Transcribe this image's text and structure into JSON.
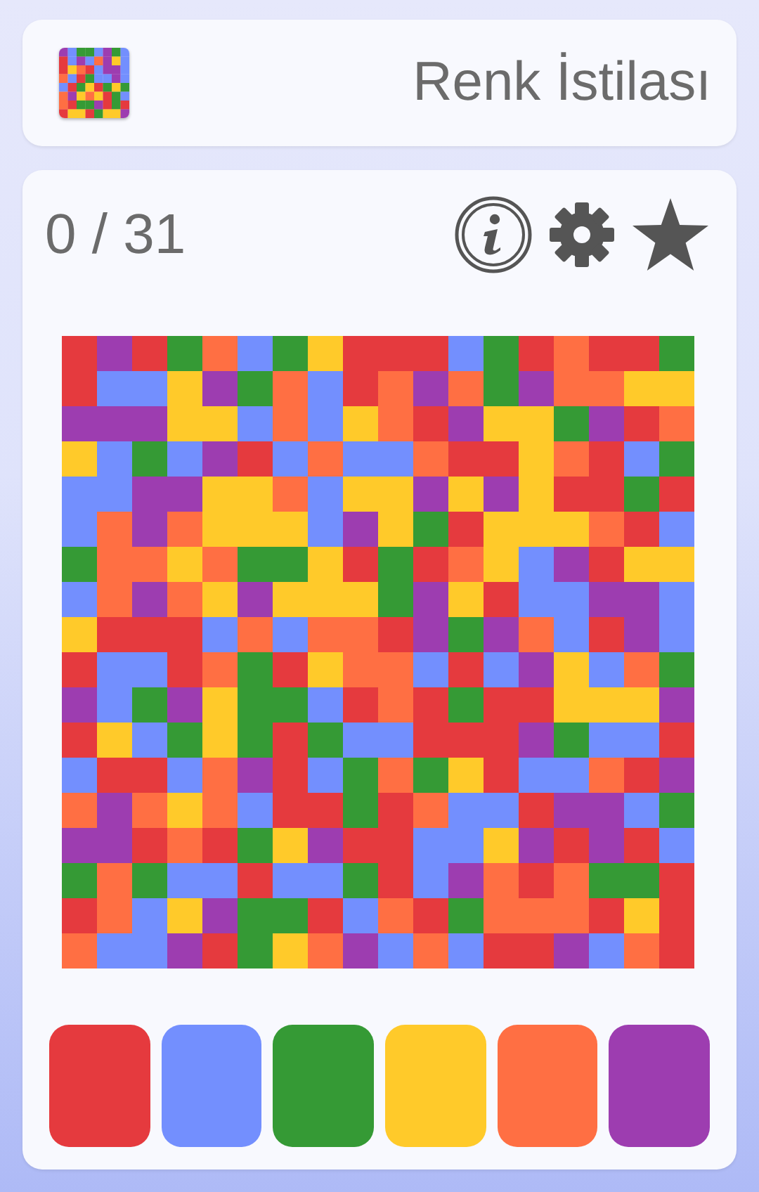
{
  "header": {
    "title": "Renk İstilası"
  },
  "score": {
    "text": "0 / 31"
  },
  "colors": [
    {
      "color": "#e53a3e"
    },
    {
      "color": "#738ffe"
    },
    {
      "color": "#359a35"
    },
    {
      "color": "#ffca2a"
    },
    {
      "color": "#ff6f43"
    },
    {
      "color": "#9d3db0"
    }
  ],
  "board": {
    "rows": [
      {
        "cells": [
          {
            "color": "#e53a3e"
          },
          {
            "color": "#9d3db0"
          },
          {
            "color": "#e53a3e"
          },
          {
            "color": "#359a35"
          },
          {
            "color": "#ff6f43"
          },
          {
            "color": "#738ffe"
          },
          {
            "color": "#359a35"
          },
          {
            "color": "#ffca2a"
          },
          {
            "color": "#e53a3e"
          },
          {
            "color": "#e53a3e"
          },
          {
            "color": "#e53a3e"
          },
          {
            "color": "#738ffe"
          },
          {
            "color": "#359a35"
          },
          {
            "color": "#e53a3e"
          },
          {
            "color": "#ff6f43"
          },
          {
            "color": "#e53a3e"
          },
          {
            "color": "#e53a3e"
          },
          {
            "color": "#359a35"
          }
        ]
      },
      {
        "cells": [
          {
            "color": "#e53a3e"
          },
          {
            "color": "#738ffe"
          },
          {
            "color": "#738ffe"
          },
          {
            "color": "#ffca2a"
          },
          {
            "color": "#9d3db0"
          },
          {
            "color": "#359a35"
          },
          {
            "color": "#ff6f43"
          },
          {
            "color": "#738ffe"
          },
          {
            "color": "#e53a3e"
          },
          {
            "color": "#ff6f43"
          },
          {
            "color": "#9d3db0"
          },
          {
            "color": "#ff6f43"
          },
          {
            "color": "#359a35"
          },
          {
            "color": "#9d3db0"
          },
          {
            "color": "#ff6f43"
          },
          {
            "color": "#ff6f43"
          },
          {
            "color": "#ffca2a"
          },
          {
            "color": "#ffca2a"
          }
        ]
      },
      {
        "cells": [
          {
            "color": "#9d3db0"
          },
          {
            "color": "#9d3db0"
          },
          {
            "color": "#9d3db0"
          },
          {
            "color": "#ffca2a"
          },
          {
            "color": "#ffca2a"
          },
          {
            "color": "#738ffe"
          },
          {
            "color": "#ff6f43"
          },
          {
            "color": "#738ffe"
          },
          {
            "color": "#ffca2a"
          },
          {
            "color": "#ff6f43"
          },
          {
            "color": "#e53a3e"
          },
          {
            "color": "#9d3db0"
          },
          {
            "color": "#ffca2a"
          },
          {
            "color": "#ffca2a"
          },
          {
            "color": "#359a35"
          },
          {
            "color": "#9d3db0"
          },
          {
            "color": "#e53a3e"
          },
          {
            "color": "#ff6f43"
          }
        ]
      },
      {
        "cells": [
          {
            "color": "#ffca2a"
          },
          {
            "color": "#738ffe"
          },
          {
            "color": "#359a35"
          },
          {
            "color": "#738ffe"
          },
          {
            "color": "#9d3db0"
          },
          {
            "color": "#e53a3e"
          },
          {
            "color": "#738ffe"
          },
          {
            "color": "#ff6f43"
          },
          {
            "color": "#738ffe"
          },
          {
            "color": "#738ffe"
          },
          {
            "color": "#ff6f43"
          },
          {
            "color": "#e53a3e"
          },
          {
            "color": "#e53a3e"
          },
          {
            "color": "#ffca2a"
          },
          {
            "color": "#ff6f43"
          },
          {
            "color": "#e53a3e"
          },
          {
            "color": "#738ffe"
          },
          {
            "color": "#359a35"
          }
        ]
      },
      {
        "cells": [
          {
            "color": "#738ffe"
          },
          {
            "color": "#738ffe"
          },
          {
            "color": "#9d3db0"
          },
          {
            "color": "#9d3db0"
          },
          {
            "color": "#ffca2a"
          },
          {
            "color": "#ffca2a"
          },
          {
            "color": "#ff6f43"
          },
          {
            "color": "#738ffe"
          },
          {
            "color": "#ffca2a"
          },
          {
            "color": "#ffca2a"
          },
          {
            "color": "#9d3db0"
          },
          {
            "color": "#ffca2a"
          },
          {
            "color": "#9d3db0"
          },
          {
            "color": "#ffca2a"
          },
          {
            "color": "#e53a3e"
          },
          {
            "color": "#e53a3e"
          },
          {
            "color": "#359a35"
          },
          {
            "color": "#e53a3e"
          }
        ]
      },
      {
        "cells": [
          {
            "color": "#738ffe"
          },
          {
            "color": "#ff6f43"
          },
          {
            "color": "#9d3db0"
          },
          {
            "color": "#ff6f43"
          },
          {
            "color": "#ffca2a"
          },
          {
            "color": "#ffca2a"
          },
          {
            "color": "#ffca2a"
          },
          {
            "color": "#738ffe"
          },
          {
            "color": "#9d3db0"
          },
          {
            "color": "#ffca2a"
          },
          {
            "color": "#359a35"
          },
          {
            "color": "#e53a3e"
          },
          {
            "color": "#ffca2a"
          },
          {
            "color": "#ffca2a"
          },
          {
            "color": "#ffca2a"
          },
          {
            "color": "#ff6f43"
          },
          {
            "color": "#e53a3e"
          },
          {
            "color": "#738ffe"
          }
        ]
      },
      {
        "cells": [
          {
            "color": "#359a35"
          },
          {
            "color": "#ff6f43"
          },
          {
            "color": "#ff6f43"
          },
          {
            "color": "#ffca2a"
          },
          {
            "color": "#ff6f43"
          },
          {
            "color": "#359a35"
          },
          {
            "color": "#359a35"
          },
          {
            "color": "#ffca2a"
          },
          {
            "color": "#e53a3e"
          },
          {
            "color": "#359a35"
          },
          {
            "color": "#e53a3e"
          },
          {
            "color": "#ff6f43"
          },
          {
            "color": "#ffca2a"
          },
          {
            "color": "#738ffe"
          },
          {
            "color": "#9d3db0"
          },
          {
            "color": "#e53a3e"
          },
          {
            "color": "#ffca2a"
          },
          {
            "color": "#ffca2a"
          }
        ]
      },
      {
        "cells": [
          {
            "color": "#738ffe"
          },
          {
            "color": "#ff6f43"
          },
          {
            "color": "#9d3db0"
          },
          {
            "color": "#ff6f43"
          },
          {
            "color": "#ffca2a"
          },
          {
            "color": "#9d3db0"
          },
          {
            "color": "#ffca2a"
          },
          {
            "color": "#ffca2a"
          },
          {
            "color": "#ffca2a"
          },
          {
            "color": "#359a35"
          },
          {
            "color": "#9d3db0"
          },
          {
            "color": "#ffca2a"
          },
          {
            "color": "#e53a3e"
          },
          {
            "color": "#738ffe"
          },
          {
            "color": "#738ffe"
          },
          {
            "color": "#9d3db0"
          },
          {
            "color": "#9d3db0"
          },
          {
            "color": "#738ffe"
          }
        ]
      },
      {
        "cells": [
          {
            "color": "#ffca2a"
          },
          {
            "color": "#e53a3e"
          },
          {
            "color": "#e53a3e"
          },
          {
            "color": "#e53a3e"
          },
          {
            "color": "#738ffe"
          },
          {
            "color": "#ff6f43"
          },
          {
            "color": "#738ffe"
          },
          {
            "color": "#ff6f43"
          },
          {
            "color": "#ff6f43"
          },
          {
            "color": "#e53a3e"
          },
          {
            "color": "#9d3db0"
          },
          {
            "color": "#359a35"
          },
          {
            "color": "#9d3db0"
          },
          {
            "color": "#ff6f43"
          },
          {
            "color": "#738ffe"
          },
          {
            "color": "#e53a3e"
          },
          {
            "color": "#9d3db0"
          },
          {
            "color": "#738ffe"
          }
        ]
      },
      {
        "cells": [
          {
            "color": "#e53a3e"
          },
          {
            "color": "#738ffe"
          },
          {
            "color": "#738ffe"
          },
          {
            "color": "#e53a3e"
          },
          {
            "color": "#ff6f43"
          },
          {
            "color": "#359a35"
          },
          {
            "color": "#e53a3e"
          },
          {
            "color": "#ffca2a"
          },
          {
            "color": "#ff6f43"
          },
          {
            "color": "#ff6f43"
          },
          {
            "color": "#738ffe"
          },
          {
            "color": "#e53a3e"
          },
          {
            "color": "#738ffe"
          },
          {
            "color": "#9d3db0"
          },
          {
            "color": "#ffca2a"
          },
          {
            "color": "#738ffe"
          },
          {
            "color": "#ff6f43"
          },
          {
            "color": "#359a35"
          }
        ]
      },
      {
        "cells": [
          {
            "color": "#9d3db0"
          },
          {
            "color": "#738ffe"
          },
          {
            "color": "#359a35"
          },
          {
            "color": "#9d3db0"
          },
          {
            "color": "#ffca2a"
          },
          {
            "color": "#359a35"
          },
          {
            "color": "#359a35"
          },
          {
            "color": "#738ffe"
          },
          {
            "color": "#e53a3e"
          },
          {
            "color": "#ff6f43"
          },
          {
            "color": "#e53a3e"
          },
          {
            "color": "#359a35"
          },
          {
            "color": "#e53a3e"
          },
          {
            "color": "#e53a3e"
          },
          {
            "color": "#ffca2a"
          },
          {
            "color": "#ffca2a"
          },
          {
            "color": "#ffca2a"
          },
          {
            "color": "#9d3db0"
          }
        ]
      },
      {
        "cells": [
          {
            "color": "#e53a3e"
          },
          {
            "color": "#ffca2a"
          },
          {
            "color": "#738ffe"
          },
          {
            "color": "#359a35"
          },
          {
            "color": "#ffca2a"
          },
          {
            "color": "#359a35"
          },
          {
            "color": "#e53a3e"
          },
          {
            "color": "#359a35"
          },
          {
            "color": "#738ffe"
          },
          {
            "color": "#738ffe"
          },
          {
            "color": "#e53a3e"
          },
          {
            "color": "#e53a3e"
          },
          {
            "color": "#e53a3e"
          },
          {
            "color": "#9d3db0"
          },
          {
            "color": "#359a35"
          },
          {
            "color": "#738ffe"
          },
          {
            "color": "#738ffe"
          },
          {
            "color": "#e53a3e"
          }
        ]
      },
      {
        "cells": [
          {
            "color": "#738ffe"
          },
          {
            "color": "#e53a3e"
          },
          {
            "color": "#e53a3e"
          },
          {
            "color": "#738ffe"
          },
          {
            "color": "#ff6f43"
          },
          {
            "color": "#9d3db0"
          },
          {
            "color": "#e53a3e"
          },
          {
            "color": "#738ffe"
          },
          {
            "color": "#359a35"
          },
          {
            "color": "#ff6f43"
          },
          {
            "color": "#359a35"
          },
          {
            "color": "#ffca2a"
          },
          {
            "color": "#e53a3e"
          },
          {
            "color": "#738ffe"
          },
          {
            "color": "#738ffe"
          },
          {
            "color": "#ff6f43"
          },
          {
            "color": "#e53a3e"
          },
          {
            "color": "#9d3db0"
          }
        ]
      },
      {
        "cells": [
          {
            "color": "#ff6f43"
          },
          {
            "color": "#9d3db0"
          },
          {
            "color": "#ff6f43"
          },
          {
            "color": "#ffca2a"
          },
          {
            "color": "#ff6f43"
          },
          {
            "color": "#738ffe"
          },
          {
            "color": "#e53a3e"
          },
          {
            "color": "#e53a3e"
          },
          {
            "color": "#359a35"
          },
          {
            "color": "#e53a3e"
          },
          {
            "color": "#ff6f43"
          },
          {
            "color": "#738ffe"
          },
          {
            "color": "#738ffe"
          },
          {
            "color": "#e53a3e"
          },
          {
            "color": "#9d3db0"
          },
          {
            "color": "#9d3db0"
          },
          {
            "color": "#738ffe"
          },
          {
            "color": "#359a35"
          }
        ]
      },
      {
        "cells": [
          {
            "color": "#9d3db0"
          },
          {
            "color": "#9d3db0"
          },
          {
            "color": "#e53a3e"
          },
          {
            "color": "#ff6f43"
          },
          {
            "color": "#e53a3e"
          },
          {
            "color": "#359a35"
          },
          {
            "color": "#ffca2a"
          },
          {
            "color": "#9d3db0"
          },
          {
            "color": "#e53a3e"
          },
          {
            "color": "#e53a3e"
          },
          {
            "color": "#738ffe"
          },
          {
            "color": "#738ffe"
          },
          {
            "color": "#ffca2a"
          },
          {
            "color": "#9d3db0"
          },
          {
            "color": "#e53a3e"
          },
          {
            "color": "#9d3db0"
          },
          {
            "color": "#e53a3e"
          },
          {
            "color": "#738ffe"
          }
        ]
      },
      {
        "cells": [
          {
            "color": "#359a35"
          },
          {
            "color": "#ff6f43"
          },
          {
            "color": "#359a35"
          },
          {
            "color": "#738ffe"
          },
          {
            "color": "#738ffe"
          },
          {
            "color": "#e53a3e"
          },
          {
            "color": "#738ffe"
          },
          {
            "color": "#738ffe"
          },
          {
            "color": "#359a35"
          },
          {
            "color": "#e53a3e"
          },
          {
            "color": "#738ffe"
          },
          {
            "color": "#9d3db0"
          },
          {
            "color": "#ff6f43"
          },
          {
            "color": "#e53a3e"
          },
          {
            "color": "#ff6f43"
          },
          {
            "color": "#359a35"
          },
          {
            "color": "#359a35"
          },
          {
            "color": "#e53a3e"
          }
        ]
      },
      {
        "cells": [
          {
            "color": "#e53a3e"
          },
          {
            "color": "#ff6f43"
          },
          {
            "color": "#738ffe"
          },
          {
            "color": "#ffca2a"
          },
          {
            "color": "#9d3db0"
          },
          {
            "color": "#359a35"
          },
          {
            "color": "#359a35"
          },
          {
            "color": "#e53a3e"
          },
          {
            "color": "#738ffe"
          },
          {
            "color": "#ff6f43"
          },
          {
            "color": "#e53a3e"
          },
          {
            "color": "#359a35"
          },
          {
            "color": "#ff6f43"
          },
          {
            "color": "#ff6f43"
          },
          {
            "color": "#ff6f43"
          },
          {
            "color": "#e53a3e"
          },
          {
            "color": "#ffca2a"
          },
          {
            "color": "#e53a3e"
          }
        ]
      },
      {
        "cells": [
          {
            "color": "#ff6f43"
          },
          {
            "color": "#738ffe"
          },
          {
            "color": "#738ffe"
          },
          {
            "color": "#9d3db0"
          },
          {
            "color": "#e53a3e"
          },
          {
            "color": "#359a35"
          },
          {
            "color": "#ffca2a"
          },
          {
            "color": "#ff6f43"
          },
          {
            "color": "#9d3db0"
          },
          {
            "color": "#738ffe"
          },
          {
            "color": "#ff6f43"
          },
          {
            "color": "#738ffe"
          },
          {
            "color": "#e53a3e"
          },
          {
            "color": "#e53a3e"
          },
          {
            "color": "#9d3db0"
          },
          {
            "color": "#738ffe"
          },
          {
            "color": "#ff6f43"
          },
          {
            "color": "#e53a3e"
          }
        ]
      }
    ]
  }
}
